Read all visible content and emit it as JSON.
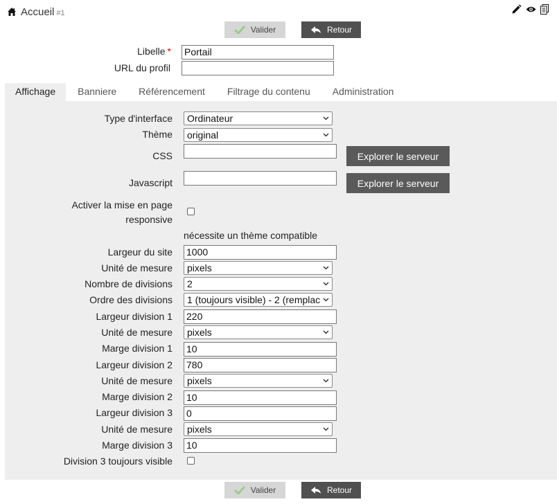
{
  "breadcrumb": {
    "title": "Accueil",
    "id": "#1"
  },
  "toolbar": {
    "icons": [
      "pencil-icon",
      "eye-icon",
      "copy-icon"
    ]
  },
  "actions": {
    "valider": "Valider",
    "retour": "Retour"
  },
  "header_form": {
    "libelle_label": "Libelle",
    "required_mark": "*",
    "libelle_value": "Portail",
    "url_label": "URL du profil",
    "url_value": ""
  },
  "tabs": [
    {
      "label": "Affichage",
      "active": true
    },
    {
      "label": "Banniere",
      "active": false
    },
    {
      "label": "Référencement",
      "active": false
    },
    {
      "label": "Filtrage du contenu",
      "active": false
    },
    {
      "label": "Administration",
      "active": false
    }
  ],
  "affichage": {
    "type_interface": {
      "label": "Type d'interface",
      "value": "Ordinateur"
    },
    "theme": {
      "label": "Thème",
      "value": "original"
    },
    "css": {
      "label": "CSS",
      "value": "",
      "button": "Explorer le serveur"
    },
    "javascript": {
      "label": "Javascript",
      "value": "",
      "button": "Explorer le serveur"
    },
    "responsive": {
      "label_line1": "Activer la mise en page",
      "label_line2": "responsive",
      "checked": false,
      "note": "nécessite un thème compatible"
    },
    "largeur_site": {
      "label": "Largeur du site",
      "value": "1000"
    },
    "unite_site": {
      "label": "Unité de mesure",
      "value": "pixels"
    },
    "nb_divisions": {
      "label": "Nombre de divisions",
      "value": "2"
    },
    "ordre_divisions": {
      "label": "Ordre des divisions",
      "value": "1 (toujours visible) - 2 (remplac"
    },
    "largeur_div1": {
      "label": "Largeur division 1",
      "value": "220"
    },
    "unite_div1": {
      "label": "Unité de mesure",
      "value": "pixels"
    },
    "marge_div1": {
      "label": "Marge division 1",
      "value": "10"
    },
    "largeur_div2": {
      "label": "Largeur division 2",
      "value": "780"
    },
    "unite_div2": {
      "label": "Unité de mesure",
      "value": "pixels"
    },
    "marge_div2": {
      "label": "Marge division 2",
      "value": "10"
    },
    "largeur_div3": {
      "label": "Largeur division 3",
      "value": "0"
    },
    "unite_div3": {
      "label": "Unité de mesure",
      "value": "pixels"
    },
    "marge_div3": {
      "label": "Marge division 3",
      "value": "10"
    },
    "div3_visible": {
      "label": "Division 3 toujours visible",
      "checked": false
    }
  }
}
